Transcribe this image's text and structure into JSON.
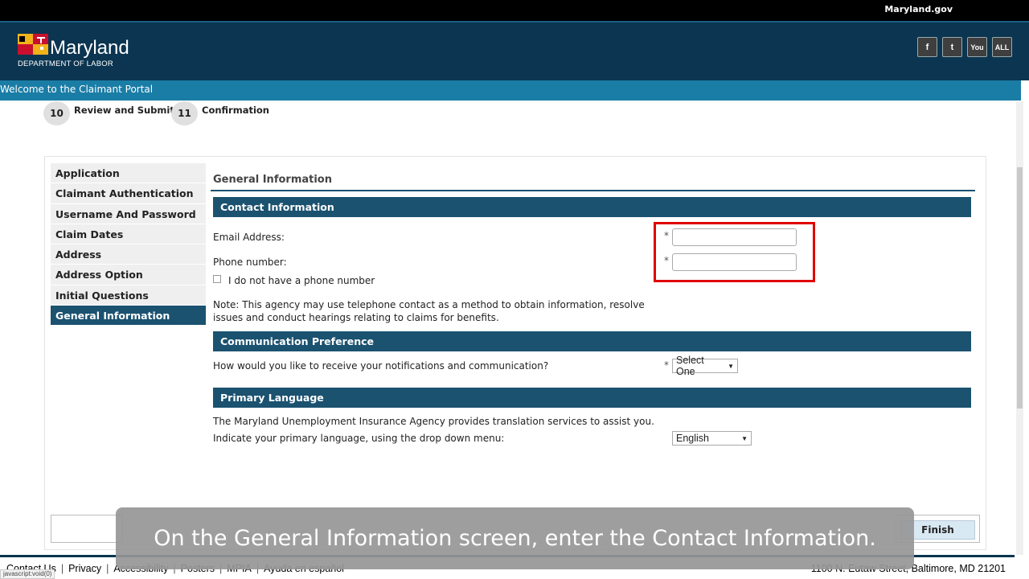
{
  "topbar": {
    "gov_link": "Maryland.gov"
  },
  "brand": {
    "name": "Maryland",
    "subtitle": "DEPARTMENT OF LABOR"
  },
  "social": {
    "facebook": "f",
    "twitter": "t",
    "youtube": "You",
    "all": "ALL"
  },
  "welcome": "Welcome to the Claimant Portal",
  "steps": [
    {
      "num": "10",
      "label": "Review and Submit"
    },
    {
      "num": "11",
      "label": "Confirmation"
    }
  ],
  "nav": {
    "items": [
      "Application",
      "Claimant Authentication",
      "Username And Password",
      "Claim Dates",
      "Address",
      "Address Option",
      "Initial Questions",
      "General Information"
    ],
    "active": "General Information"
  },
  "main": {
    "title": "General Information",
    "contact": {
      "header": "Contact Information",
      "email_label": "Email Address:",
      "phone_label": "Phone number:",
      "email_value": "",
      "phone_value": "",
      "no_phone_label": "I do not have a phone number",
      "required_mark": "*",
      "note_line1": "Note: This agency may use telephone contact as a method to obtain information, resolve",
      "note_line2": "issues and conduct hearings relating to claims for benefits."
    },
    "communication": {
      "header": "Communication Preference",
      "question": "How would you like to receive your notifications and communication?",
      "selected": "Select One"
    },
    "language": {
      "header": "Primary Language",
      "info": "The Maryland Unemployment Insurance Agency provides translation services to assist you.",
      "prompt": "Indicate your primary language, using the drop down menu:",
      "selected": "English"
    }
  },
  "buttons": {
    "finish": "Finish"
  },
  "footer": {
    "links": [
      "Contact Us",
      "Privacy",
      "Accessibility",
      "Posters",
      "MPIA",
      "Ayuda en español"
    ],
    "address": "1100 N. Eutaw Street, Baltimore, MD 21201"
  },
  "status_url": "javascript:void(0)",
  "caption": "On the General Information screen, enter the Contact Information.",
  "colors": {
    "header_bg": "#0b3550",
    "welcome_bg": "#1a7da6",
    "section_bar": "#1b5270",
    "highlight": "#e00000"
  }
}
